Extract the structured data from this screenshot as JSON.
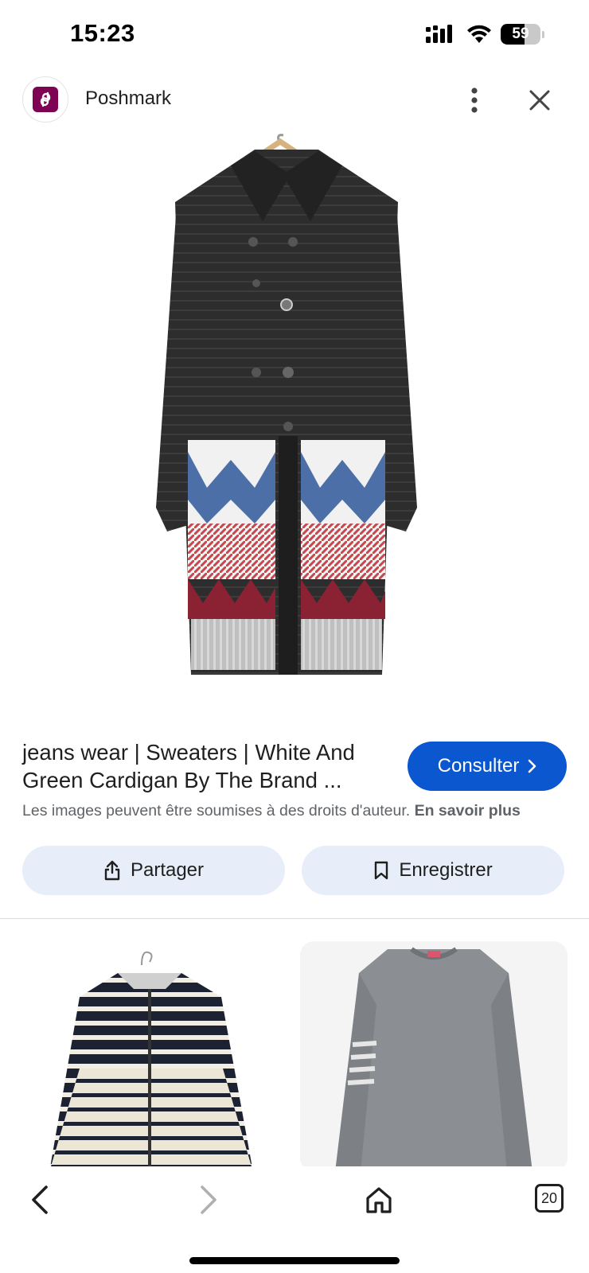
{
  "status_bar": {
    "time": "15:23",
    "battery_level": "59",
    "battery_percent": 59,
    "icons": [
      "signal-icon",
      "wifi-icon",
      "battery-icon"
    ]
  },
  "header": {
    "source_name": "Poshmark",
    "icons": [
      "poshmark-logo-icon",
      "more-vert-icon",
      "close-icon"
    ]
  },
  "main_image": {
    "icon": "cardigan-image"
  },
  "result": {
    "title": "jeans wear | Sweaters | White And Green Cardigan By The Brand ...",
    "visit_label": "Consulter",
    "copyright_notice": "Les images peuvent être soumises à des droits d'auteur.",
    "learn_more": "En savoir plus"
  },
  "actions": {
    "share_label": "Partager",
    "save_label": "Enregistrer"
  },
  "related": {
    "items": [
      {
        "icon": "striped-cardigan-image"
      },
      {
        "icon": "grey-sweater-image"
      }
    ]
  },
  "bottom_nav": {
    "tab_count": "20",
    "icons": [
      "back-icon",
      "forward-icon",
      "home-icon",
      "tabs-icon"
    ]
  },
  "colors": {
    "accent": "#0b57d0",
    "action_bg": "#e8eef9",
    "brand_poshmark": "#7f0353",
    "text_primary": "#1f1f1f",
    "text_secondary": "#5f6368"
  }
}
